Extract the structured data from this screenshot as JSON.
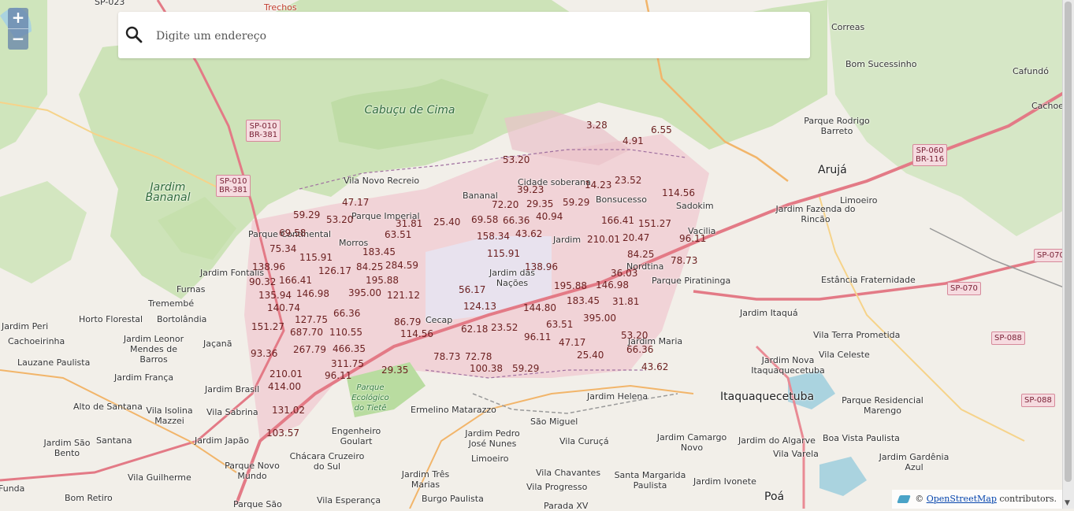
{
  "search": {
    "placeholder": "Digite um endereço"
  },
  "zoom": {
    "in_label": "+",
    "out_label": "−"
  },
  "attribution": {
    "prefix": "©",
    "link": "OpenStreetMap",
    "suffix": "contributors."
  },
  "places": [
    {
      "text": "Trechos",
      "cls": "red"
    },
    {
      "text": "SP-023",
      "cls": ""
    },
    {
      "text": "Correas",
      "cls": ""
    },
    {
      "text": "Bom Sucessinho",
      "cls": ""
    },
    {
      "text": "Cafundó",
      "cls": ""
    },
    {
      "text": "Cachoei",
      "cls": ""
    },
    {
      "text": "Cabuçu de Cima",
      "cls": "park"
    },
    {
      "text": "Parque Rodrigo Barreto",
      "cls": ""
    },
    {
      "text": "Arujá",
      "cls": "big"
    },
    {
      "text": "Jardim Bananal",
      "cls": "park"
    },
    {
      "text": "Vila Novo Recreio",
      "cls": ""
    },
    {
      "text": "Bananal",
      "cls": ""
    },
    {
      "text": "Cidade soberana",
      "cls": ""
    },
    {
      "text": "Bonsucesso",
      "cls": ""
    },
    {
      "text": "Sadokim",
      "cls": ""
    },
    {
      "text": "Jardim Fazenda do Rincão",
      "cls": ""
    },
    {
      "text": "Limoeiro",
      "cls": ""
    },
    {
      "text": "Parque Imperial",
      "cls": ""
    },
    {
      "text": "Parque Continental",
      "cls": ""
    },
    {
      "text": "Morros",
      "cls": ""
    },
    {
      "text": "Jardim Fontalis",
      "cls": ""
    },
    {
      "text": "Furnas",
      "cls": ""
    },
    {
      "text": "Tremembé",
      "cls": ""
    },
    {
      "text": "Horto Florestal",
      "cls": ""
    },
    {
      "text": "Bortolândia",
      "cls": ""
    },
    {
      "text": "Jardim Peri",
      "cls": ""
    },
    {
      "text": "Cachoeirinha",
      "cls": ""
    },
    {
      "text": "Jardim Leonor Mendes de Barros",
      "cls": ""
    },
    {
      "text": "Jaçanã",
      "cls": ""
    },
    {
      "text": "Lauzane Paulista",
      "cls": ""
    },
    {
      "text": "Jardim França",
      "cls": ""
    },
    {
      "text": "Jardim Brasil",
      "cls": ""
    },
    {
      "text": "Alto de Santana",
      "cls": ""
    },
    {
      "text": "Vila Isolina Mazzei",
      "cls": ""
    },
    {
      "text": "Vila Sabrina",
      "cls": ""
    },
    {
      "text": "Jardim São Bento",
      "cls": ""
    },
    {
      "text": "Santana",
      "cls": ""
    },
    {
      "text": "Jardim Japão",
      "cls": ""
    },
    {
      "text": "Vila Guilherme",
      "cls": ""
    },
    {
      "text": "Bom Retiro",
      "cls": ""
    },
    {
      "text": "Funda",
      "cls": ""
    },
    {
      "text": "Parque Novo Mundo",
      "cls": ""
    },
    {
      "text": "Parque São",
      "cls": ""
    },
    {
      "text": "Vila Esperança",
      "cls": ""
    },
    {
      "text": "Chácara Cruzeiro do Sul",
      "cls": ""
    },
    {
      "text": "Engenheiro Goulart",
      "cls": ""
    },
    {
      "text": "Parque Ecológico do Tietê",
      "cls": "parksmall"
    },
    {
      "text": "Ermelino Matarazzo",
      "cls": ""
    },
    {
      "text": "São Miguel",
      "cls": ""
    },
    {
      "text": "Jardim Pedro José Nunes",
      "cls": ""
    },
    {
      "text": "Limoeiro",
      "cls": ""
    },
    {
      "text": "Jardim Três Marias",
      "cls": ""
    },
    {
      "text": "Burgo Paulista",
      "cls": ""
    },
    {
      "text": "Vila Curuçá",
      "cls": ""
    },
    {
      "text": "Vila Chavantes",
      "cls": ""
    },
    {
      "text": "Vila Progresso",
      "cls": ""
    },
    {
      "text": "Parada XV",
      "cls": ""
    },
    {
      "text": "Jardim Helena",
      "cls": ""
    },
    {
      "text": "Jardim Camargo Novo",
      "cls": ""
    },
    {
      "text": "Santa Margarida Paulista",
      "cls": ""
    },
    {
      "text": "Jardim Ivonete",
      "cls": ""
    },
    {
      "text": "Poá",
      "cls": "big"
    },
    {
      "text": "Itaquaquecetuba",
      "cls": "big"
    },
    {
      "text": "Jardim do Algarve",
      "cls": ""
    },
    {
      "text": "Vila Varela",
      "cls": ""
    },
    {
      "text": "Boa Vista Paulista",
      "cls": ""
    },
    {
      "text": "Jardim Gardênia Azul",
      "cls": ""
    },
    {
      "text": "Parque Residencial Marengo",
      "cls": ""
    },
    {
      "text": "Vila Terra Prometida",
      "cls": ""
    },
    {
      "text": "Vila Celeste",
      "cls": ""
    },
    {
      "text": "Jardim Nova Itaquaquecetuba",
      "cls": ""
    },
    {
      "text": "Jardim Itaquá",
      "cls": ""
    },
    {
      "text": "Estância Fraternidade",
      "cls": ""
    },
    {
      "text": "Parque Piratininga",
      "cls": ""
    },
    {
      "text": "Jardim Maria",
      "cls": ""
    },
    {
      "text": "Jardim das Nações",
      "cls": ""
    },
    {
      "text": "Cecap",
      "cls": ""
    },
    {
      "text": "Jardim",
      "cls": ""
    },
    {
      "text": "Nordtina",
      "cls": ""
    },
    {
      "text": "Vacilia",
      "cls": ""
    }
  ],
  "shields": [
    "SP-010 BR-381",
    "SP-010 BR-381",
    "SP-060 BR-116",
    "SP-070",
    "SP-070",
    "SP-088",
    "SP-088"
  ],
  "markers": [
    "3.28",
    "6.55",
    "4.91",
    "53.20",
    "39.23",
    "14.23",
    "23.52",
    "114.56",
    "72.20",
    "29.35",
    "59.29",
    "40.94",
    "47.17",
    "59.29",
    "53.20",
    "31.81",
    "25.40",
    "69.58",
    "66.36",
    "166.41",
    "151.27",
    "69.58",
    "63.51",
    "158.34",
    "43.62",
    "210.01",
    "20.47",
    "96.11",
    "75.34",
    "183.45",
    "115.91",
    "84.25",
    "78.73",
    "115.91",
    "126.17",
    "84.25",
    "284.59",
    "138.96",
    "138.96",
    "90.32",
    "166.41",
    "195.88",
    "36.03",
    "135.94",
    "146.98",
    "395.00",
    "121.12",
    "56.17",
    "195.88",
    "146.98",
    "140.74",
    "124.13",
    "183.45",
    "31.81",
    "66.36",
    "144.80",
    "127.75",
    "86.79",
    "395.00",
    "151.27",
    "687.70",
    "110.55",
    "114.56",
    "62.18",
    "23.52",
    "63.51",
    "96.11",
    "53.20",
    "47.17",
    "267.79",
    "466.35",
    "66.36",
    "93.36",
    "78.73",
    "72.78",
    "25.40",
    "311.75",
    "100.38",
    "59.29",
    "43.62",
    "29.35",
    "210.01",
    "96.11",
    "414.00",
    "131.02",
    "103.57"
  ]
}
